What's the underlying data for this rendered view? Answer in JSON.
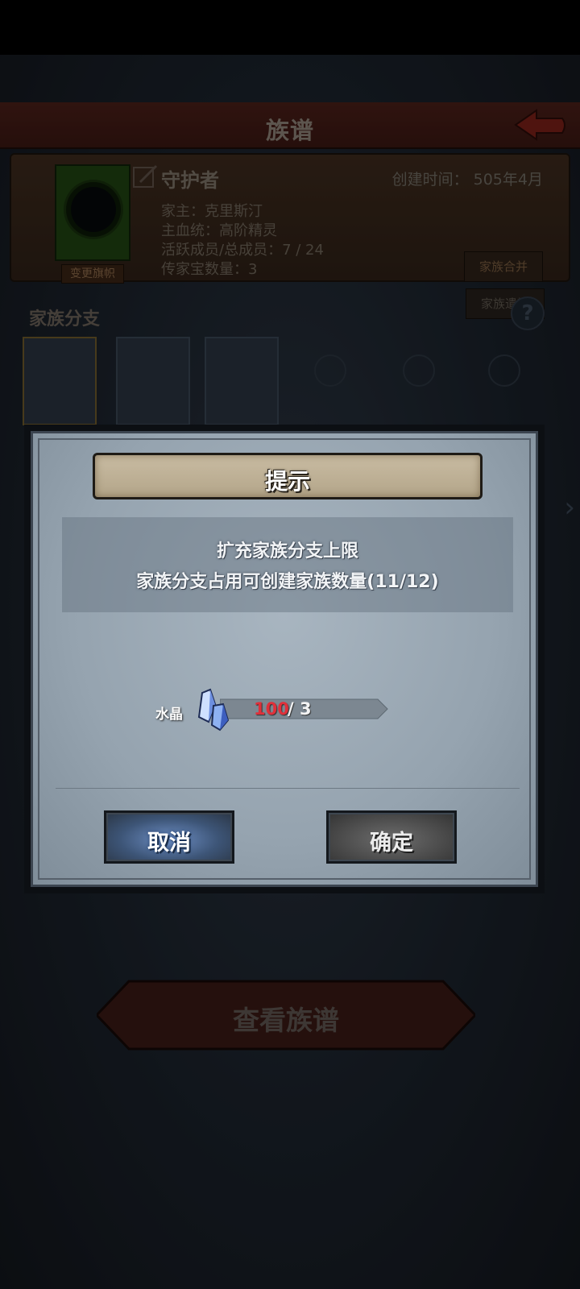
{
  "header": {
    "title": "族谱"
  },
  "family": {
    "name": "守护者",
    "created": "创建时间： 505年4月",
    "lord": "家主：克里斯汀",
    "bloodline": "主血统：高阶精灵",
    "members": "活跃成员/总成员：7 / 24",
    "heirlooms": "传家宝数量：3",
    "change_banner": "变更旗帜",
    "merge": "家族合并",
    "dissolve": "家族遣散"
  },
  "branches": {
    "label": "家族分支",
    "help": "?"
  },
  "view_tree": "查看族谱",
  "dialog": {
    "title": "提示",
    "message_line1": "扩充家族分支上限",
    "message_line2": "家族分支占用可创建家族数量(11/12)",
    "cost": {
      "label": "水晶",
      "have": "100",
      "need": "/ 3"
    },
    "cancel": "取消",
    "confirm": "确定"
  },
  "colors": {
    "cancel_button": "#3d5577",
    "confirm_button": "#4d4d4d",
    "have_amount": "#e0303a"
  }
}
